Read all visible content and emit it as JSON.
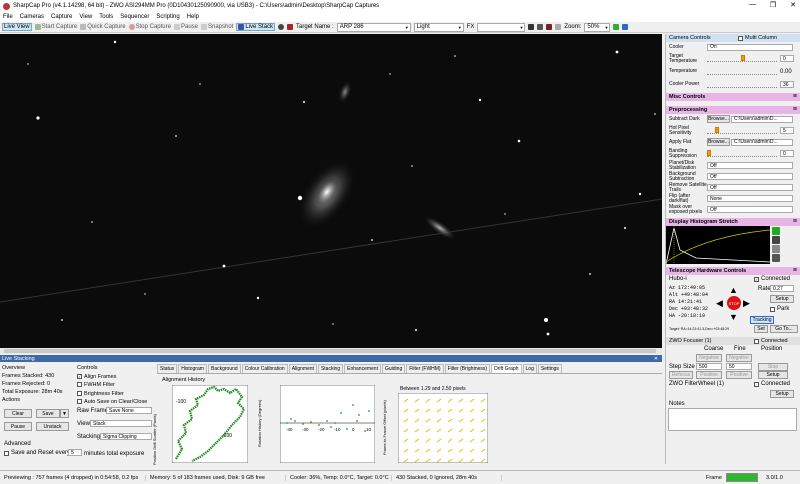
{
  "titlebar": {
    "title": "SharpCap Pro (v4.1.14298, 64 bit) - ZWO ASI294MM Pro (0D10430125090900, via USB3) - C:\\Users\\admin\\Desktop\\SharpCap Captures"
  },
  "menu": [
    "File",
    "Cameras",
    "Capture",
    "View",
    "Tools",
    "Sequencer",
    "Scripting",
    "Help"
  ],
  "toolbar": {
    "live_view": "Live View",
    "start_capture": "Start Capture",
    "quick_capture": "Quick Capture",
    "stop_capture": "Stop Capture",
    "pause": "Pause",
    "snapshot": "Snapshot",
    "live_stack": "Live Stack",
    "target_name_label": "Target Name :",
    "target_name_value": "ARP 286",
    "frame_type": "Light",
    "fx_label": "FX",
    "zoom_label": "Zoom:",
    "zoom_value": "50%"
  },
  "camera_controls": {
    "title": "Camera Controls",
    "multi_column": "Multi Column",
    "cooler_label": "Cooler",
    "cooler_value": "On",
    "target_temp_label": "Target Temperature",
    "target_temp_value": "0",
    "temperature_label": "Temperature",
    "temperature_value": "0.00",
    "cooler_power_label": "Cooler Power",
    "cooler_power_value": "36"
  },
  "misc_controls": {
    "title": "Misc Controls"
  },
  "preprocessing": {
    "title": "Preprocessing",
    "subtract_dark_label": "Subtract Dark",
    "browse": "Browse...",
    "dark_path": "C:\\Users\\admin\\D...",
    "hot_pixel_label": "Hot Pixel Sensitivity",
    "hot_pixel_value": "5",
    "apply_flat_label": "Apply Flat",
    "flat_path": "C:\\Users\\admin\\D...",
    "banding_label": "Banding Suppression",
    "banding_value": "0",
    "planet_disk_label": "Planet/Disk Stabilization",
    "planet_disk_value": "Off",
    "bg_sub_label": "Background Subtraction",
    "bg_sub_value": "Off",
    "remove_trails_label": "Remove Satellite Trails",
    "remove_trails_value": "Off",
    "flip_label": "Flip (after dark/flat)",
    "flip_value": "None",
    "mask_label": "Mask over exposed pixels",
    "mask_value": "Off"
  },
  "histogram": {
    "title": "Display Histogram Stretch"
  },
  "telescope": {
    "title": "Telescope Hardware Controls",
    "device": "Hubo-i",
    "connected": "Connected",
    "az_label": "Az",
    "az_value": "172:49:05",
    "alt_label": "Alt",
    "alt_value": "+49:48:04",
    "ra_label": "RA",
    "ra_value": "14:21:41",
    "dec_label": "Dec",
    "dec_value": "+03:48:32",
    "ha_label": "HA",
    "ha_value": "-20:18:19",
    "rate_label": "Rate:",
    "rate_value": "0.27",
    "setup": "Setup",
    "park": "Park",
    "tracking": "Tracking",
    "stop": "STOP",
    "target_line": "Target: RA=14:21:41.3,Dec=+03:48:29",
    "set": "Set",
    "goto": "Go To..."
  },
  "focuser": {
    "title": "ZWO Focuser (1)",
    "connected": "Connected",
    "coarse": "Coarse",
    "fine": "Fine",
    "position": "Position",
    "negative": "Negative",
    "step_size_label": "Step Size",
    "coarse_step": "500",
    "fine_step": "50",
    "stop": "Stop",
    "refocus": "Refocus",
    "positive": "Positive",
    "setup": "Setup"
  },
  "filterwheel": {
    "title": "ZWO FilterWheel (1)",
    "connected": "Connected",
    "setup": "Setup"
  },
  "notes": {
    "title": "Notes"
  },
  "live_stacking": {
    "title": "Live Stacking",
    "overview": "Overview",
    "frames_stacked_label": "Frames Stacked:",
    "frames_stacked": "430",
    "frames_rejected_label": "Frames Rejected:",
    "frames_rejected": "0",
    "total_exposure_label": "Total Exposure:",
    "total_exposure": "28m 40s",
    "actions": "Actions",
    "clear": "Clear",
    "save": "Save",
    "pause": "Pause",
    "unstack": "Unstack",
    "advanced": "Advanced",
    "save_reset": "Save and Reset every",
    "save_reset_value": "5",
    "minutes_label": "minutes total exposure",
    "controls": "Controls",
    "align_frames": "Align Frames",
    "fwhm_filter": "FWHM Filter",
    "brightness_filter": "Brightness Filter",
    "auto_save": "Auto Save on Clear/Close",
    "raw_frames_label": "Raw Frames",
    "raw_frames_value": "Save None",
    "view_label": "View",
    "view_value": "Stack",
    "stacking_label": "Stacking",
    "stacking_value": "Sigma Clipping"
  },
  "tabs": [
    "Status",
    "Histogram",
    "Background",
    "Colour Calibration",
    "Alignment",
    "Stacking",
    "Enhancement",
    "Guiding",
    "Filter (FWHM)",
    "Filter (Brightness)",
    "Drift Graph",
    "Log",
    "Settings"
  ],
  "active_tab": "Drift Graph",
  "drift": {
    "alignment_history": "Alignment History",
    "ylabel1": "Position Drift Scatter (Pixels)",
    "ylabel2": "Rotation History (Degrees)",
    "ylabel3": "Frame-to-Frame Offset (pixels)",
    "between_label": "Between 1.29 and 2.50 pixels",
    "ticks1": [
      "-100",
      "-100"
    ],
    "ticks2": [
      "-40",
      "-30",
      "-20",
      "-10",
      "0",
      "10"
    ]
  },
  "statusbar": {
    "preview": "Previewing : 757 frames (4 dropped) in 0:54:58, 0.2 fps",
    "memory": "Memory: 5 of 183 frames used, Disk: 9 GB free",
    "cooler": "Cooler: 36%, Temp: 0.0°C, Target: 0.0°C",
    "stacked": "430 Stacked, 0 Ignored, 28m 40s",
    "frame_label": "Frame",
    "version": "3.0/1.0"
  }
}
